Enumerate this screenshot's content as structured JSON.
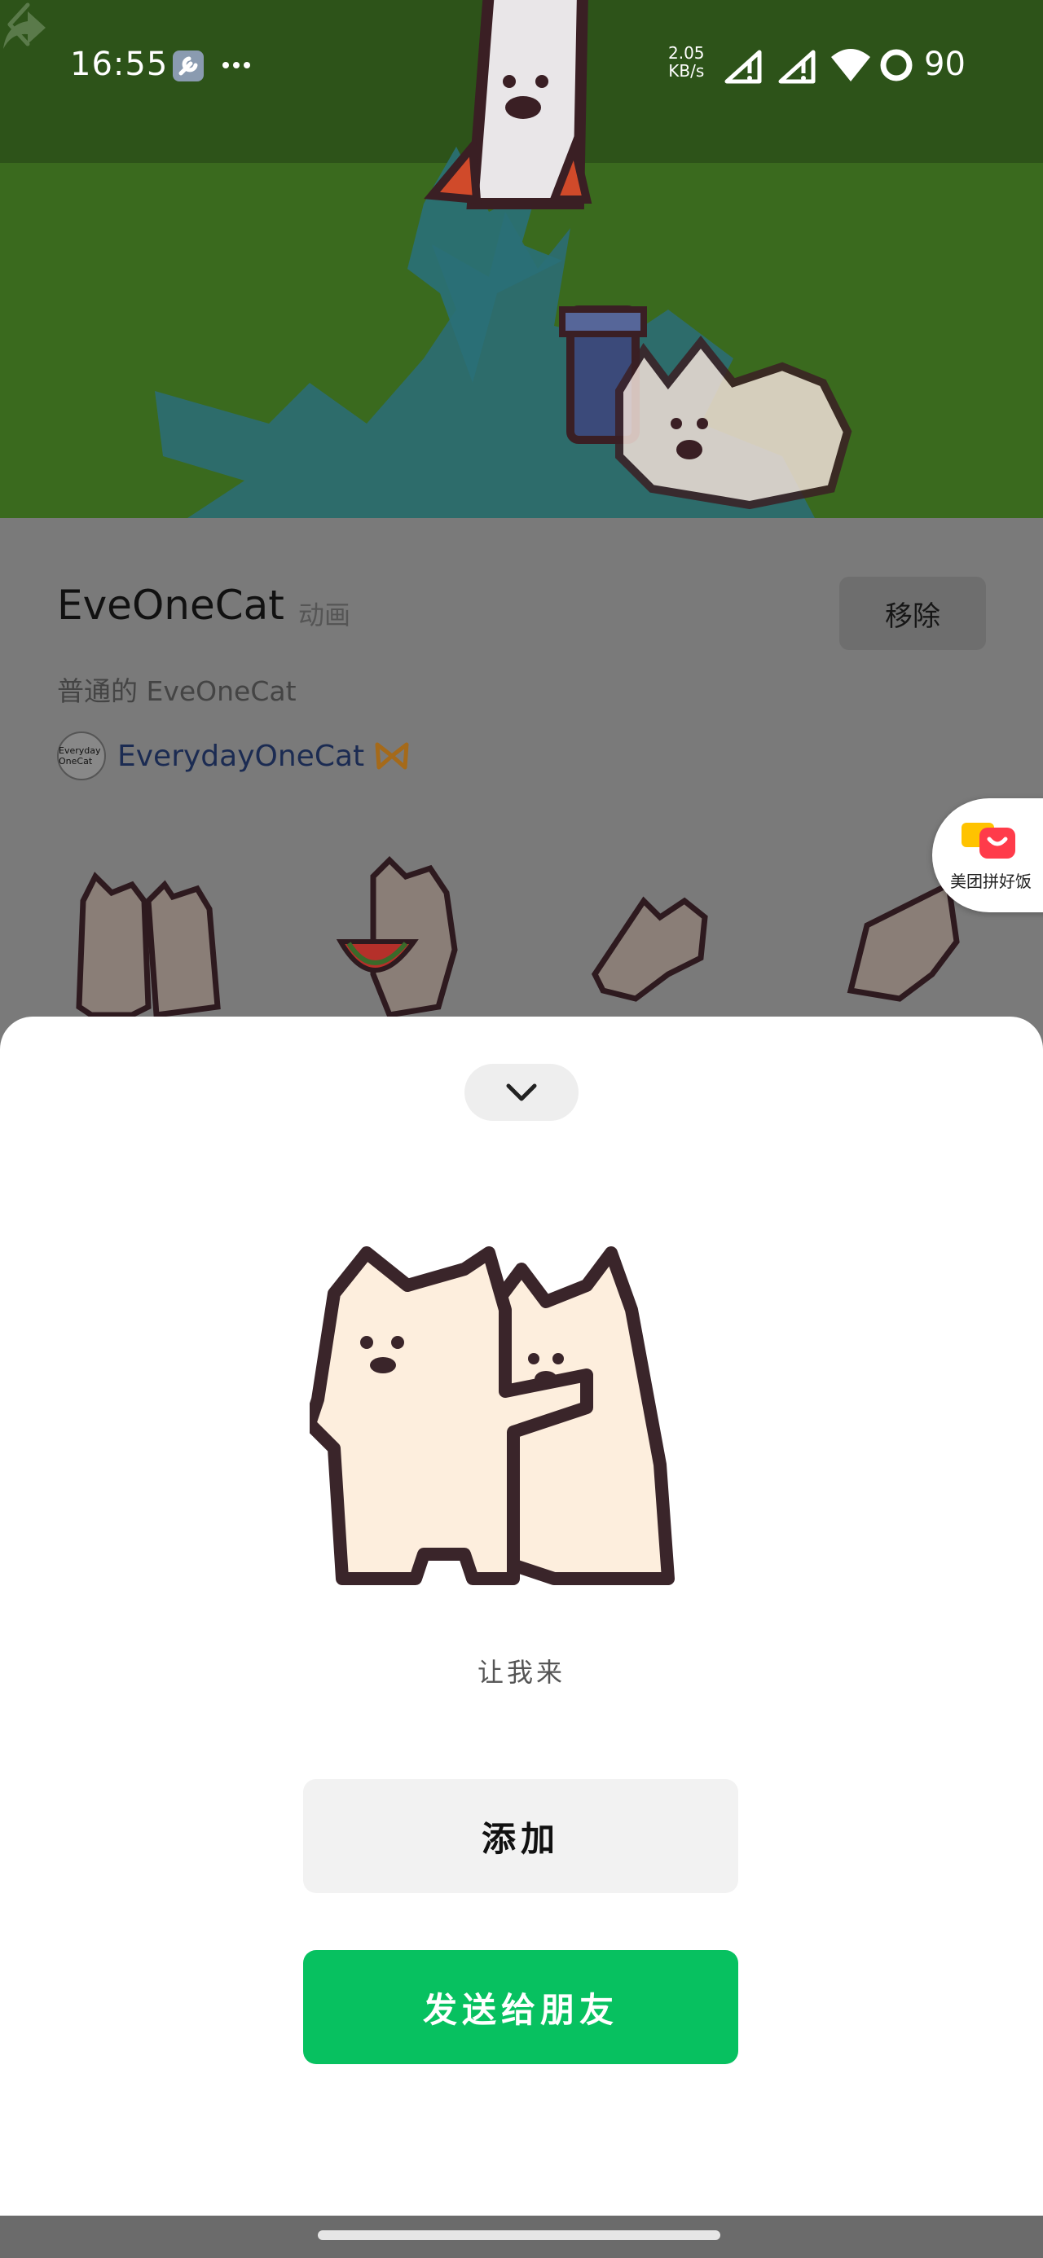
{
  "status_bar": {
    "time": "16:55",
    "net_speed_value": "2.05",
    "net_speed_unit": "KB/s",
    "battery": "90",
    "icons": [
      "wrench-icon",
      "more-dots-icon",
      "signal-icon",
      "signal-icon",
      "wifi-icon",
      "battery-ring-icon"
    ]
  },
  "header": {
    "back_icon": "chevron-left-icon",
    "share_icon": "share-arrow-icon"
  },
  "pack": {
    "title": "EveOneCat",
    "type": "动画",
    "description": "普通的 EveOneCat",
    "author_avatar_text": "Everyday OneCat",
    "author": "EverydayOneCat",
    "remove_label": "移除"
  },
  "ad": {
    "label": "美团拼好饭"
  },
  "sheet": {
    "collapse_icon": "chevron-down-icon",
    "sticker_caption": "让我来",
    "add_label": "添加",
    "send_label": "发送给朋友"
  },
  "colors": {
    "primary_green": "#07c160",
    "banner_green": "#2f5a1c",
    "dim_overlay": "#7a7a7a"
  }
}
